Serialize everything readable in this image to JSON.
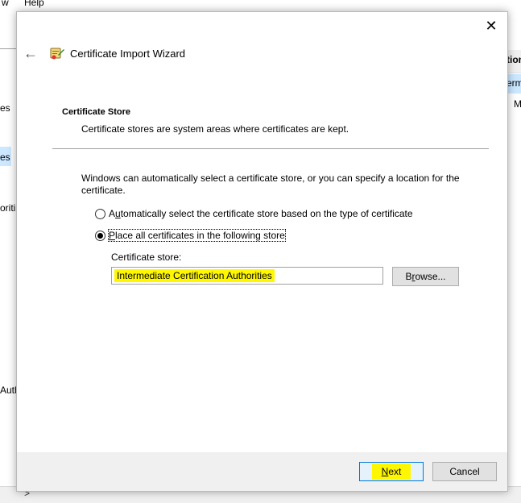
{
  "background": {
    "menu": [
      "w",
      "Help"
    ],
    "left_fragments": [
      "es",
      "es",
      "oriti",
      "Auth"
    ],
    "right_fragments": [
      "tion",
      "erm",
      "M"
    ]
  },
  "dialog": {
    "title": "Certificate Import Wizard",
    "section_title": "Certificate Store",
    "section_desc": "Certificate stores are system areas where certificates are kept.",
    "intro": "Windows can automatically select a certificate store, or you can specify a location for the certificate.",
    "options": {
      "auto": {
        "prefix": "A",
        "mnemonic": "u",
        "rest": "tomatically select the certificate store based on the type of certificate",
        "selected": false
      },
      "place": {
        "mnemonic": "P",
        "rest": "lace all certificates in the following store",
        "selected": true
      }
    },
    "store_label": "Certificate store:",
    "store_value": "Intermediate Certification Authorities",
    "browse": {
      "prefix": "B",
      "mnemonic": "r",
      "rest": "owse..."
    },
    "next": {
      "mnemonic": "N",
      "rest": "ext"
    },
    "cancel": "Cancel",
    "colors": {
      "highlight": "#fff700",
      "focus_border": "#0078d7"
    }
  }
}
